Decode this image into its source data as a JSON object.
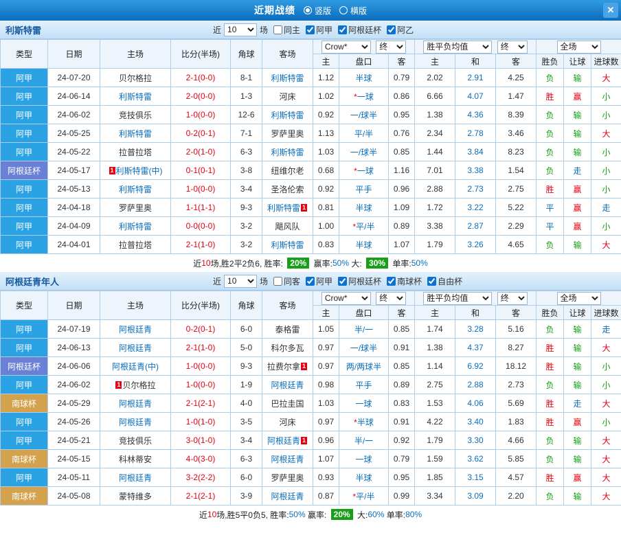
{
  "titlebar": {
    "title": "近期战绩",
    "view_vertical": "竖版",
    "view_horizontal": "横版",
    "close_glyph": "✕"
  },
  "labels": {
    "near": "近",
    "games": "场"
  },
  "table_header": {
    "type": "类型",
    "date": "日期",
    "home": "主场",
    "score": "比分(半场)",
    "corner": "角球",
    "away": "客场",
    "odds_company": "Crow*",
    "stage": "终",
    "euro_label": "胜平负均值",
    "scope": "全场",
    "sub": [
      "主",
      "盘口",
      "客",
      "主",
      "和",
      "客",
      "胜负",
      "让球",
      "进球数"
    ]
  },
  "sections": [
    {
      "team": "利斯特雷",
      "filters": {
        "count": "10",
        "checks": [
          {
            "label": "同主",
            "checked": false
          },
          {
            "label": "阿甲",
            "checked": true
          },
          {
            "label": "阿根廷杯",
            "checked": true
          },
          {
            "label": "阿乙",
            "checked": true
          }
        ]
      },
      "rows": [
        {
          "lg": "阿甲",
          "lgc": "ajia",
          "date": "24-07-20",
          "home": {
            "n": "贝尔格拉",
            "f": false
          },
          "score": "2-1(0-0)",
          "corner": "8-1",
          "away": {
            "n": "利斯特雷",
            "f": true
          },
          "asia": [
            "1.12",
            "半球",
            "0.79"
          ],
          "euro": [
            "2.02",
            "2.91",
            "4.25"
          ],
          "res": [
            [
              "负",
              "l"
            ],
            [
              "输",
              "l"
            ],
            [
              "大",
              "w"
            ]
          ]
        },
        {
          "lg": "阿甲",
          "lgc": "ajia",
          "date": "24-06-14",
          "home": {
            "n": "利斯特雷",
            "f": true
          },
          "score": "2-0(0-0)",
          "corner": "1-3",
          "away": {
            "n": "河床",
            "f": false
          },
          "asia": [
            "1.02",
            "*一球",
            "0.86"
          ],
          "euro": [
            "6.66",
            "4.07",
            "1.47"
          ],
          "res": [
            [
              "胜",
              "w"
            ],
            [
              "赢",
              "w"
            ],
            [
              "小",
              "l"
            ]
          ]
        },
        {
          "lg": "阿甲",
          "lgc": "ajia",
          "date": "24-06-02",
          "home": {
            "n": "竞技俱乐",
            "f": false
          },
          "score": "1-0(0-0)",
          "corner": "12-6",
          "away": {
            "n": "利斯特雷",
            "f": true
          },
          "asia": [
            "0.92",
            "一/球半",
            "0.95"
          ],
          "euro": [
            "1.38",
            "4.36",
            "8.39"
          ],
          "res": [
            [
              "负",
              "l"
            ],
            [
              "输",
              "l"
            ],
            [
              "小",
              "l"
            ]
          ]
        },
        {
          "lg": "阿甲",
          "lgc": "ajia",
          "date": "24-05-25",
          "home": {
            "n": "利斯特雷",
            "f": true
          },
          "score": "0-2(0-1)",
          "corner": "7-1",
          "away": {
            "n": "罗萨里奥",
            "f": false
          },
          "asia": [
            "1.13",
            "平/半",
            "0.76"
          ],
          "euro": [
            "2.34",
            "2.78",
            "3.46"
          ],
          "res": [
            [
              "负",
              "l"
            ],
            [
              "输",
              "l"
            ],
            [
              "大",
              "w"
            ]
          ]
        },
        {
          "lg": "阿甲",
          "lgc": "ajia",
          "date": "24-05-22",
          "home": {
            "n": "拉普拉塔",
            "f": false
          },
          "score": "2-0(1-0)",
          "corner": "6-3",
          "away": {
            "n": "利斯特雷",
            "f": true
          },
          "asia": [
            "1.03",
            "一/球半",
            "0.85"
          ],
          "euro": [
            "1.44",
            "3.84",
            "8.23"
          ],
          "res": [
            [
              "负",
              "l"
            ],
            [
              "输",
              "l"
            ],
            [
              "小",
              "l"
            ]
          ]
        },
        {
          "lg": "阿根廷杯",
          "lgc": "cup",
          "date": "24-05-17",
          "home": {
            "n": "利斯特雷(中)",
            "f": true,
            "cb": "1"
          },
          "score": "0-1(0-1)",
          "corner": "3-8",
          "away": {
            "n": "纽维尔老",
            "f": false
          },
          "asia": [
            "0.68",
            "*一球",
            "1.16"
          ],
          "euro": [
            "7.01",
            "3.38",
            "1.54"
          ],
          "res": [
            [
              "负",
              "l"
            ],
            [
              "走",
              "d"
            ],
            [
              "小",
              "l"
            ]
          ]
        },
        {
          "lg": "阿甲",
          "lgc": "ajia",
          "date": "24-05-13",
          "home": {
            "n": "利斯特雷",
            "f": true
          },
          "score": "1-0(0-0)",
          "corner": "3-4",
          "away": {
            "n": "圣洛伦索",
            "f": false
          },
          "asia": [
            "0.92",
            "平手",
            "0.96"
          ],
          "euro": [
            "2.88",
            "2.73",
            "2.75"
          ],
          "res": [
            [
              "胜",
              "w"
            ],
            [
              "赢",
              "w"
            ],
            [
              "小",
              "l"
            ]
          ]
        },
        {
          "lg": "阿甲",
          "lgc": "ajia",
          "date": "24-04-18",
          "home": {
            "n": "罗萨里奥",
            "f": false
          },
          "score": "1-1(1-1)",
          "corner": "9-3",
          "away": {
            "n": "利斯特雷",
            "f": true,
            "ca": "1"
          },
          "asia": [
            "0.81",
            "半球",
            "1.09"
          ],
          "euro": [
            "1.72",
            "3.22",
            "5.22"
          ],
          "res": [
            [
              "平",
              "d"
            ],
            [
              "赢",
              "w"
            ],
            [
              "走",
              "d"
            ]
          ]
        },
        {
          "lg": "阿甲",
          "lgc": "ajia",
          "date": "24-04-09",
          "home": {
            "n": "利斯特雷",
            "f": true
          },
          "score": "0-0(0-0)",
          "corner": "3-2",
          "away": {
            "n": "飓风队",
            "f": false
          },
          "asia": [
            "1.00",
            "*平/半",
            "0.89"
          ],
          "euro": [
            "3.38",
            "2.87",
            "2.29"
          ],
          "res": [
            [
              "平",
              "d"
            ],
            [
              "赢",
              "w"
            ],
            [
              "小",
              "l"
            ]
          ]
        },
        {
          "lg": "阿甲",
          "lgc": "ajia",
          "date": "24-04-01",
          "home": {
            "n": "拉普拉塔",
            "f": false
          },
          "score": "2-1(1-0)",
          "corner": "3-2",
          "away": {
            "n": "利斯特雷",
            "f": true
          },
          "asia": [
            "0.83",
            "半球",
            "1.07"
          ],
          "euro": [
            "1.79",
            "3.26",
            "4.65"
          ],
          "res": [
            [
              "负",
              "l"
            ],
            [
              "输",
              "l"
            ],
            [
              "大",
              "w"
            ]
          ]
        }
      ],
      "footer": [
        [
          "近",
          "t"
        ],
        [
          "10",
          "r"
        ],
        [
          "场,胜2平2负6, 胜率: ",
          "t"
        ],
        [
          "20%",
          "g"
        ],
        [
          " 赢率:",
          "t"
        ],
        [
          "50%",
          "b"
        ],
        [
          " 大: ",
          "t"
        ],
        [
          "30%",
          "g"
        ],
        [
          " 单率:",
          "t"
        ],
        [
          "50%",
          "b"
        ]
      ]
    },
    {
      "team": "阿根廷青年人",
      "filters": {
        "count": "10",
        "checks": [
          {
            "label": "同客",
            "checked": false
          },
          {
            "label": "阿甲",
            "checked": true
          },
          {
            "label": "阿根廷杯",
            "checked": true
          },
          {
            "label": "南球杯",
            "checked": true
          },
          {
            "label": "自由杯",
            "checked": true
          }
        ]
      },
      "rows": [
        {
          "lg": "阿甲",
          "lgc": "ajia",
          "date": "24-07-19",
          "home": {
            "n": "阿根廷青",
            "f": true
          },
          "score": "0-2(0-1)",
          "corner": "6-0",
          "away": {
            "n": "泰格雷",
            "f": false
          },
          "asia": [
            "1.05",
            "半/一",
            "0.85"
          ],
          "euro": [
            "1.74",
            "3.28",
            "5.16"
          ],
          "res": [
            [
              "负",
              "l"
            ],
            [
              "输",
              "l"
            ],
            [
              "走",
              "d"
            ]
          ]
        },
        {
          "lg": "阿甲",
          "lgc": "ajia",
          "date": "24-06-13",
          "home": {
            "n": "阿根廷青",
            "f": true
          },
          "score": "2-1(1-0)",
          "corner": "5-0",
          "away": {
            "n": "科尔多瓦",
            "f": false
          },
          "asia": [
            "0.97",
            "一/球半",
            "0.91"
          ],
          "euro": [
            "1.38",
            "4.37",
            "8.27"
          ],
          "res": [
            [
              "胜",
              "w"
            ],
            [
              "输",
              "l"
            ],
            [
              "大",
              "w"
            ]
          ]
        },
        {
          "lg": "阿根廷杯",
          "lgc": "cup",
          "date": "24-06-06",
          "home": {
            "n": "阿根廷青(中)",
            "f": true
          },
          "score": "1-0(0-0)",
          "corner": "9-3",
          "away": {
            "n": "拉费尔拿",
            "f": false,
            "ca": "1"
          },
          "asia": [
            "0.97",
            "两/两球半",
            "0.85"
          ],
          "euro": [
            "1.14",
            "6.92",
            "18.12"
          ],
          "res": [
            [
              "胜",
              "w"
            ],
            [
              "输",
              "l"
            ],
            [
              "小",
              "l"
            ]
          ]
        },
        {
          "lg": "阿甲",
          "lgc": "ajia",
          "date": "24-06-02",
          "home": {
            "n": "贝尔格拉",
            "f": false,
            "cb": "1"
          },
          "score": "1-0(0-0)",
          "corner": "1-9",
          "away": {
            "n": "阿根廷青",
            "f": true
          },
          "asia": [
            "0.98",
            "平手",
            "0.89"
          ],
          "euro": [
            "2.75",
            "2.88",
            "2.73"
          ],
          "res": [
            [
              "负",
              "l"
            ],
            [
              "输",
              "l"
            ],
            [
              "小",
              "l"
            ]
          ]
        },
        {
          "lg": "南球杯",
          "lgc": "south",
          "date": "24-05-29",
          "home": {
            "n": "阿根廷青",
            "f": true
          },
          "score": "2-1(2-1)",
          "corner": "4-0",
          "away": {
            "n": "巴拉圭国",
            "f": false
          },
          "asia": [
            "1.03",
            "一球",
            "0.83"
          ],
          "euro": [
            "1.53",
            "4.06",
            "5.69"
          ],
          "res": [
            [
              "胜",
              "w"
            ],
            [
              "走",
              "d"
            ],
            [
              "大",
              "w"
            ]
          ]
        },
        {
          "lg": "阿甲",
          "lgc": "ajia",
          "date": "24-05-26",
          "home": {
            "n": "阿根廷青",
            "f": true
          },
          "score": "1-0(1-0)",
          "corner": "3-5",
          "away": {
            "n": "河床",
            "f": false
          },
          "asia": [
            "0.97",
            "*半球",
            "0.91"
          ],
          "euro": [
            "4.22",
            "3.40",
            "1.83"
          ],
          "res": [
            [
              "胜",
              "w"
            ],
            [
              "赢",
              "w"
            ],
            [
              "小",
              "l"
            ]
          ]
        },
        {
          "lg": "阿甲",
          "lgc": "ajia",
          "date": "24-05-21",
          "home": {
            "n": "竞技俱乐",
            "f": false
          },
          "score": "3-0(1-0)",
          "corner": "3-4",
          "away": {
            "n": "阿根廷青",
            "f": true,
            "ca": "1"
          },
          "asia": [
            "0.96",
            "半/一",
            "0.92"
          ],
          "euro": [
            "1.79",
            "3.30",
            "4.66"
          ],
          "res": [
            [
              "负",
              "l"
            ],
            [
              "输",
              "l"
            ],
            [
              "大",
              "w"
            ]
          ]
        },
        {
          "lg": "南球杯",
          "lgc": "south",
          "date": "24-05-15",
          "home": {
            "n": "科林蒂安",
            "f": false
          },
          "score": "4-0(3-0)",
          "corner": "6-3",
          "away": {
            "n": "阿根廷青",
            "f": true
          },
          "asia": [
            "1.07",
            "一球",
            "0.79"
          ],
          "euro": [
            "1.59",
            "3.62",
            "5.85"
          ],
          "res": [
            [
              "负",
              "l"
            ],
            [
              "输",
              "l"
            ],
            [
              "大",
              "w"
            ]
          ]
        },
        {
          "lg": "阿甲",
          "lgc": "ajia",
          "date": "24-05-11",
          "home": {
            "n": "阿根廷青",
            "f": true
          },
          "score": "3-2(2-2)",
          "corner": "6-0",
          "away": {
            "n": "罗萨里奥",
            "f": false
          },
          "asia": [
            "0.93",
            "半球",
            "0.95"
          ],
          "euro": [
            "1.85",
            "3.15",
            "4.57"
          ],
          "res": [
            [
              "胜",
              "w"
            ],
            [
              "赢",
              "w"
            ],
            [
              "大",
              "w"
            ]
          ]
        },
        {
          "lg": "南球杯",
          "lgc": "south",
          "date": "24-05-08",
          "home": {
            "n": "蒙特维多",
            "f": false
          },
          "score": "2-1(2-1)",
          "corner": "3-9",
          "away": {
            "n": "阿根廷青",
            "f": true
          },
          "asia": [
            "0.87",
            "*平/半",
            "0.99"
          ],
          "euro": [
            "3.34",
            "3.09",
            "2.20"
          ],
          "res": [
            [
              "负",
              "l"
            ],
            [
              "输",
              "l"
            ],
            [
              "大",
              "w"
            ]
          ]
        }
      ],
      "footer": [
        [
          "近",
          "t"
        ],
        [
          "10",
          "r"
        ],
        [
          "场,胜5平0负5, 胜率:",
          "t"
        ],
        [
          "50%",
          "b"
        ],
        [
          " 赢率: ",
          "t"
        ],
        [
          "20%",
          "g"
        ],
        [
          " 大:",
          "t"
        ],
        [
          "60%",
          "b"
        ],
        [
          " 单率:",
          "t"
        ],
        [
          "80%",
          "b"
        ]
      ]
    }
  ]
}
